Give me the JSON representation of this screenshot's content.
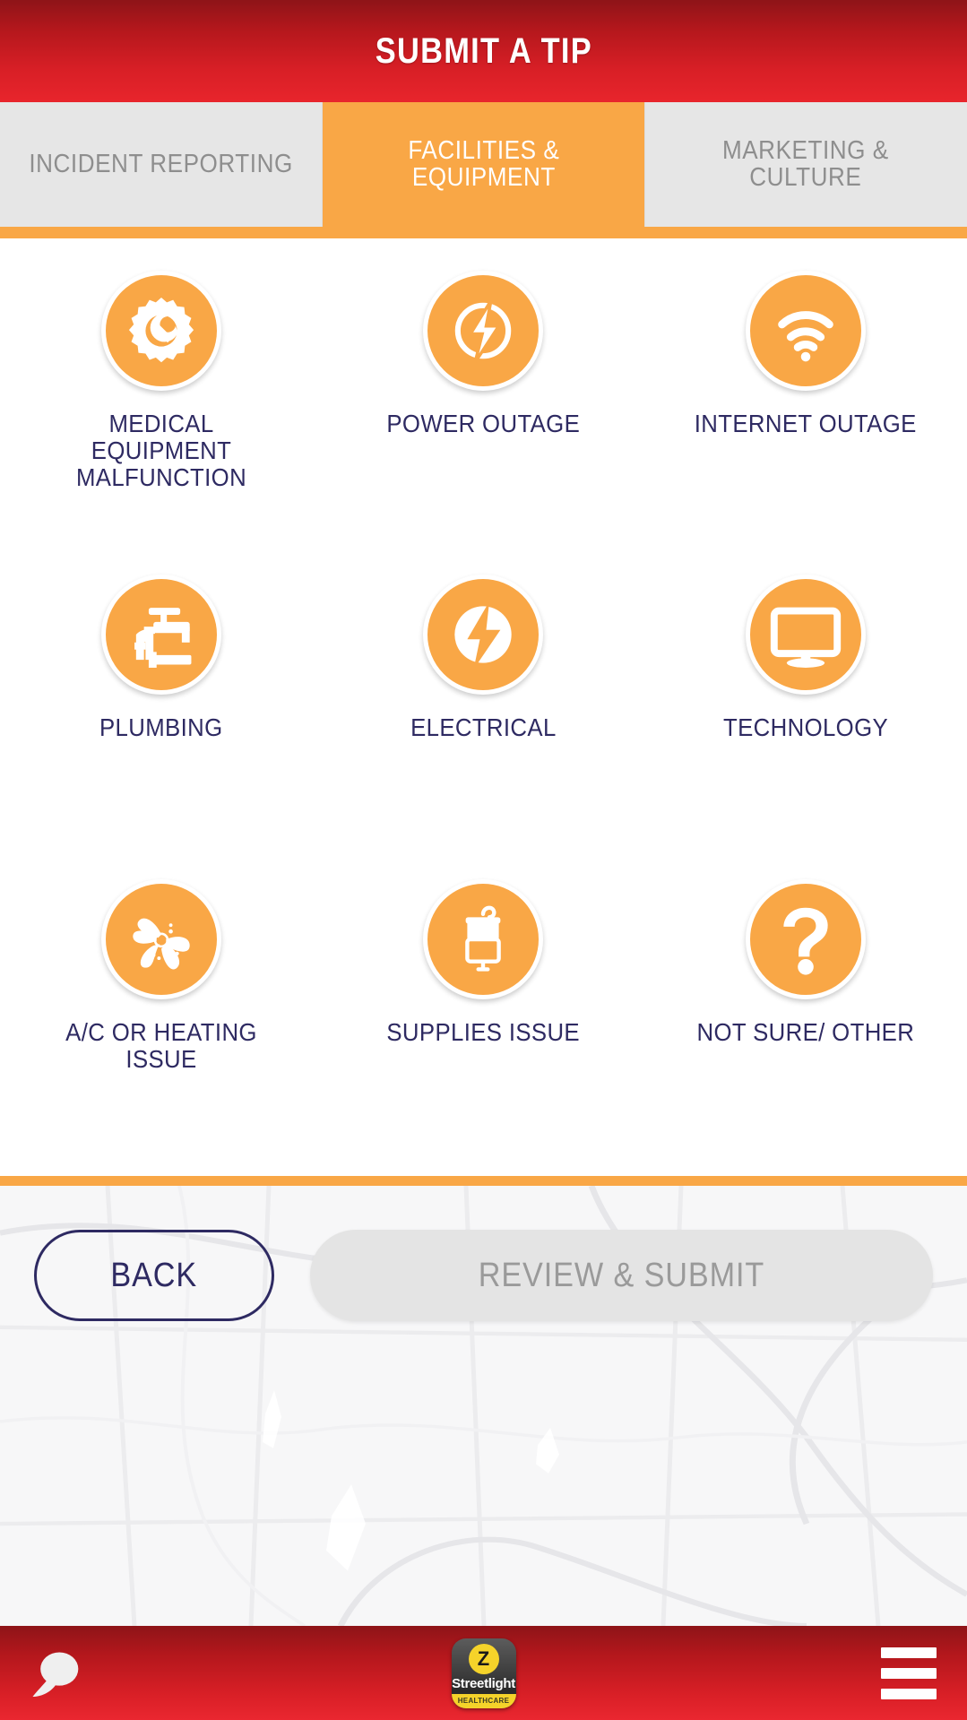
{
  "header": {
    "title": "SUBMIT A TIP",
    "bg_color_top": "#8e1418",
    "bg_color_bottom": "#e8252c"
  },
  "tabs": {
    "accent_color": "#f9a746",
    "items": [
      {
        "label": "INCIDENT REPORTING",
        "active": false
      },
      {
        "label": "FACILITIES & EQUIPMENT",
        "active": true
      },
      {
        "label": "MARKETING & CULTURE",
        "active": false
      }
    ]
  },
  "grid": {
    "icon_bg_color": "#f9a746",
    "label_color": "#2e2a62",
    "items": [
      {
        "label": "MEDICAL EQUIPMENT MALFUNCTION",
        "icon": "gear-wrench-icon"
      },
      {
        "label": "POWER OUTAGE",
        "icon": "power-outage-bolt-icon"
      },
      {
        "label": "INTERNET OUTAGE",
        "icon": "wifi-icon"
      },
      {
        "label": "PLUMBING",
        "icon": "faucet-pipe-icon"
      },
      {
        "label": "ELECTRICAL",
        "icon": "lightning-bolt-icon"
      },
      {
        "label": "TECHNOLOGY",
        "icon": "monitor-icon"
      },
      {
        "label": "A/C OR HEATING ISSUE",
        "icon": "fan-icon"
      },
      {
        "label": "SUPPLIES ISSUE",
        "icon": "iv-bag-icon"
      },
      {
        "label": "NOT SURE/ OTHER",
        "icon": "question-mark-icon"
      }
    ]
  },
  "footer": {
    "back_label": "BACK",
    "submit_label": "REVIEW & SUBMIT",
    "submit_disabled": true,
    "divider_color": "#f9a746"
  },
  "bottom_nav": {
    "chat_icon": "chat-bubble-icon",
    "menu_icon": "hamburger-menu-icon",
    "brand": {
      "mark": "Z",
      "name": "Streetlight",
      "sub": "HEALTHCARE"
    }
  }
}
